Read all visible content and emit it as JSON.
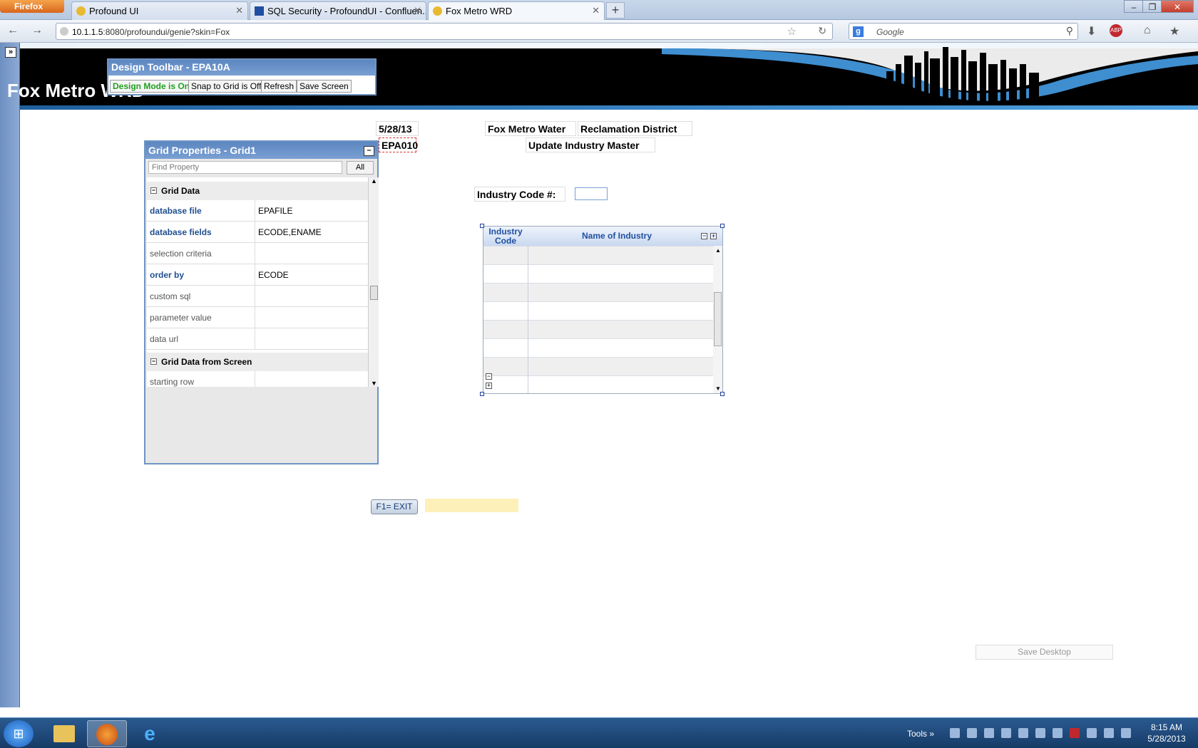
{
  "browser": {
    "menu_button": "Firefox",
    "tabs": [
      {
        "label": "Profound UI"
      },
      {
        "label": "SQL Security - ProfoundUI - Confluen..."
      },
      {
        "label": "Fox Metro WRD"
      }
    ],
    "url_host": "10.1.1.5",
    "url_rest": ":8080/profoundui/genie?skin=Fox",
    "search_placeholder": "Google"
  },
  "banner": {
    "title": "Fox Metro WRD"
  },
  "design_toolbar": {
    "title": "Design Toolbar - EPA10A",
    "buttons": [
      "Design Mode is On",
      "Snap to Grid is Off",
      "Refresh",
      "Save Screen"
    ]
  },
  "grid_properties": {
    "title": "Grid Properties - Grid1",
    "find_placeholder": "Find Property",
    "all_button": "All",
    "section1": "Grid Data",
    "rows": [
      {
        "name": "database file",
        "value": "EPAFILE"
      },
      {
        "name": "database fields",
        "value": "ECODE,ENAME"
      },
      {
        "name": "selection criteria",
        "value": ""
      },
      {
        "name": "order by",
        "value": "ECODE"
      },
      {
        "name": "custom sql",
        "value": ""
      },
      {
        "name": "parameter value",
        "value": ""
      },
      {
        "name": "data url",
        "value": ""
      }
    ],
    "section2": "Grid Data from Screen",
    "row_after": {
      "name": "starting row",
      "value": ""
    }
  },
  "form": {
    "date": "5/28/13",
    "program": "EPA010",
    "org_line1": "Fox Metro Water",
    "org_line2": "Reclamation District",
    "screen_title": "Update Industry Master",
    "industry_code_label": "Industry Code #:",
    "industry_code_value": ""
  },
  "grid": {
    "columns": [
      "Industry Code",
      "Name of Industry"
    ]
  },
  "buttons": {
    "exit": "F1= EXIT",
    "save_desktop": "Save Desktop"
  },
  "taskbar": {
    "tools": "Tools",
    "time": "8:15 AM",
    "date": "5/28/2013"
  },
  "colors": {
    "accent": "#6f94c4",
    "design_mode_on": "#21a021",
    "banner": "#000000"
  }
}
